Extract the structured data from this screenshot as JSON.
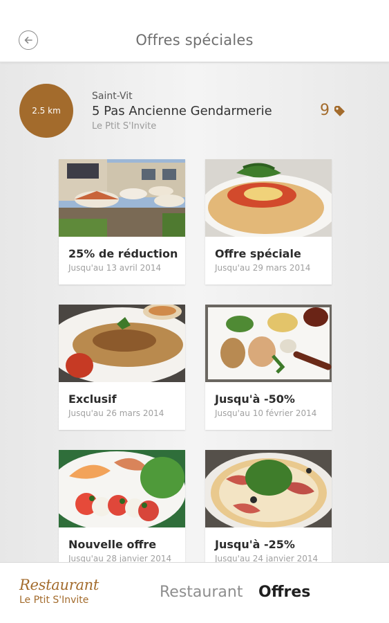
{
  "header": {
    "title": "Offres spéciales",
    "back_icon": "back-arrow-icon"
  },
  "store": {
    "distance": "2.5 km",
    "city": "Saint-Vit",
    "street": "5 Pas Ancienne Gendarmerie",
    "name": "Le Ptit S'Invite",
    "offer_count": "9",
    "count_icon": "tag-icon"
  },
  "offers": [
    {
      "title": "25% de réduction",
      "date": "Jusqu'au 13 avril 2014",
      "image": "restaurant-terrace-photo"
    },
    {
      "title": "Offre spéciale",
      "date": "Jusqu'au 29 mars 2014",
      "image": "calzone-pizza-photo"
    },
    {
      "title": "Exclusif",
      "date": "Jusqu'au 26 mars 2014",
      "image": "chicken-cream-sauce-photo"
    },
    {
      "title": "Jusqu'à -50%",
      "date": "Jusqu'au 10 février 2014",
      "image": "foie-gras-plate-photo"
    },
    {
      "title": "Nouvelle offre",
      "date": "Jusqu'au 28 janvier 2014",
      "image": "tomato-mozzarella-salad-photo"
    },
    {
      "title": "Jusqu'à -25%",
      "date": "Jusqu'au 24 janvier 2014",
      "image": "ham-arugula-pizza-photo"
    }
  ],
  "bottom_bar": {
    "logo_script": "Restaurant",
    "logo_sub": "Le Ptit S'Invite",
    "tabs": [
      {
        "label": "Restaurant"
      },
      {
        "label": "Offres"
      }
    ]
  },
  "colors": {
    "accent": "#a36b2c",
    "background": "#ececec"
  }
}
